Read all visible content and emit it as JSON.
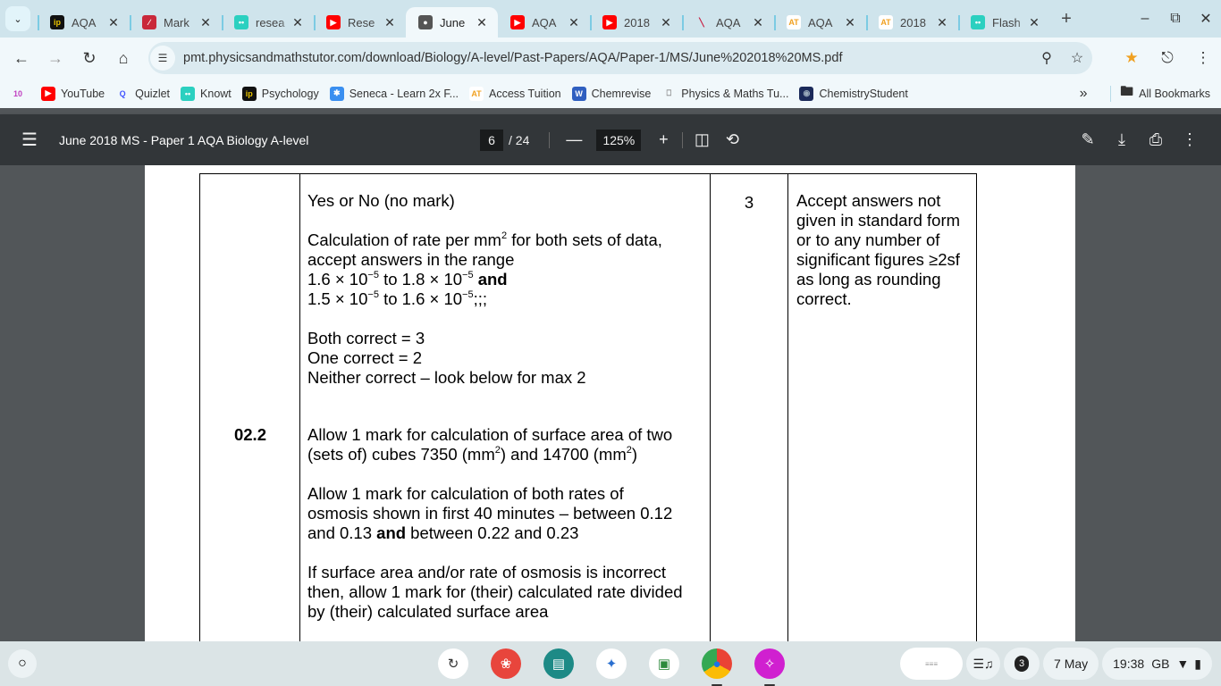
{
  "browser": {
    "tabs": [
      {
        "title": "AQA",
        "icon": "ip-icon",
        "fav_bg": "#111",
        "fav_fg": "#e9c300",
        "fav_txt": "ip"
      },
      {
        "title": "Mark",
        "icon": "markbook-icon",
        "fav_bg": "#c9283a",
        "fav_fg": "#fff",
        "fav_txt": "∕"
      },
      {
        "title": "resea",
        "icon": "knowt-icon",
        "fav_bg": "#2bd0c0",
        "fav_fg": "#fff",
        "fav_txt": "••"
      },
      {
        "title": "Rese",
        "icon": "youtube-icon",
        "fav_bg": "#f00",
        "fav_fg": "#fff",
        "fav_txt": "▶"
      },
      {
        "title": "June",
        "icon": "globe-icon",
        "fav_bg": "#555",
        "fav_fg": "#fff",
        "fav_txt": "●",
        "active": true
      },
      {
        "title": "AQA",
        "icon": "youtube-icon",
        "fav_bg": "#f00",
        "fav_fg": "#fff",
        "fav_txt": "▶"
      },
      {
        "title": "2018",
        "icon": "youtube-icon",
        "fav_bg": "#f00",
        "fav_fg": "#fff",
        "fav_txt": "▶"
      },
      {
        "title": "AQA",
        "icon": "aqa-icon",
        "fav_bg": "transparent",
        "fav_fg": "#c8173c",
        "fav_txt": "╲"
      },
      {
        "title": "AQA",
        "icon": "access-tuition-icon",
        "fav_bg": "#fff",
        "fav_fg": "#f0a020",
        "fav_txt": "AT"
      },
      {
        "title": "2018",
        "icon": "access-tuition-icon",
        "fav_bg": "#fff",
        "fav_fg": "#f0a020",
        "fav_txt": "AT"
      },
      {
        "title": "Flash",
        "icon": "knowt-icon",
        "fav_bg": "#2bd0c0",
        "fav_fg": "#fff",
        "fav_txt": "••"
      }
    ],
    "new_tab": "+",
    "window_controls": {
      "minimize": "–",
      "restore": "⧉",
      "close": "✕"
    },
    "url": "pmt.physicsandmathstutor.com/download/Biology/A-level/Past-Papers/AQA/Paper-1/MS/June%202018%20MS.pdf",
    "bookmarks": [
      {
        "label": "",
        "icon": "celebration-icon",
        "bg": "transparent",
        "fg": "#c040c0",
        "txt": "10"
      },
      {
        "label": "YouTube",
        "icon": "youtube-icon",
        "bg": "#f00",
        "fg": "#fff",
        "txt": "▶"
      },
      {
        "label": "Quizlet",
        "icon": "quizlet-icon",
        "bg": "transparent",
        "fg": "#4255ff",
        "txt": "Q"
      },
      {
        "label": "Knowt",
        "icon": "knowt-icon",
        "bg": "#2bd0c0",
        "fg": "#fff",
        "txt": "••"
      },
      {
        "label": "Psychology",
        "icon": "ip-icon",
        "bg": "#111",
        "fg": "#e9c300",
        "txt": "ip"
      },
      {
        "label": "Seneca - Learn 2x F...",
        "icon": "seneca-icon",
        "bg": "#3a8ff0",
        "fg": "#fff",
        "txt": "✱"
      },
      {
        "label": "Access Tuition",
        "icon": "access-tuition-icon",
        "bg": "#fff",
        "fg": "#f0a020",
        "txt": "AT"
      },
      {
        "label": "Chemrevise",
        "icon": "wordpress-icon",
        "bg": "#2f5fc0",
        "fg": "#fff",
        "txt": "W"
      },
      {
        "label": "Physics & Maths Tu...",
        "icon": "pmt-icon",
        "bg": "transparent",
        "fg": "#888",
        "txt": "⎕"
      },
      {
        "label": "ChemistryStudent",
        "icon": "chemistrystudent-icon",
        "bg": "#1b2a5a",
        "fg": "#9ab",
        "txt": "◉"
      }
    ],
    "more_bookmarks": "»",
    "all_bookmarks": "All Bookmarks"
  },
  "pdf_viewer": {
    "title": "June 2018 MS - Paper 1 AQA Biology A-level",
    "current_page": "6",
    "total_pages": "/ 24",
    "zoom": "125%"
  },
  "document": {
    "question_number": "02.2",
    "marks": "3",
    "answer": {
      "line1": "Yes or No (no mark)",
      "calc_pre": "Calculation of rate per mm",
      "calc_post": " for both sets of data,",
      "accept": "accept answers in the range",
      "r1a": "1.6 × 10",
      "r1b": " to 1.8 × 10",
      "and": "and",
      "r2a": "1.5 × 10",
      "r2b": " to 1.6 × 10",
      "r2end": ";;;",
      "exp": "−5",
      "sq": "2",
      "both": "Both correct = 3",
      "one": "One correct = 2",
      "neither": "Neither correct – look below for max 2",
      "sa1": "Allow 1 mark for calculation of surface area of two",
      "sa2a": "(sets of) cubes 7350 (mm",
      "sa2b": ") and 14700 (mm",
      "sa2c": ")",
      "os1": "Allow 1 mark for calculation of both rates of",
      "os2": "osmosis shown in first 40 minutes – between 0.12",
      "os3a": "and 0.13 ",
      "os3b": " between 0.22 and 0.23",
      "if1": "If surface area and/or rate of osmosis is incorrect",
      "if2": "then, allow 1 mark for (their) calculated rate divided",
      "if3": "by (their) calculated surface area"
    },
    "comments": [
      "Accept answers not",
      "given in standard form",
      "or to any number of",
      "significant figures ≥2sf",
      "as long as rounding",
      "correct."
    ]
  },
  "shelf": {
    "apps": [
      {
        "name": "cursive-app",
        "bg": "#fff",
        "fg": "#333",
        "txt": "↻"
      },
      {
        "name": "canvas-app",
        "bg": "#e8453c",
        "fg": "#fff",
        "txt": "❀"
      },
      {
        "name": "classroom-cards-app",
        "bg": "#1d8a86",
        "fg": "#fff",
        "txt": "▤"
      },
      {
        "name": "butterfly-app",
        "bg": "#fff",
        "fg": "#2a6fd0",
        "txt": "✦"
      },
      {
        "name": "google-classroom-app",
        "bg": "#fff",
        "fg": "#2d8a3c",
        "txt": "▣"
      },
      {
        "name": "chrome-app",
        "bg": "conic-gradient(#ea4335 0 33%,#fbbc05 0 66%,#34a853 0)",
        "fg": "#1a73e8",
        "txt": "●"
      },
      {
        "name": "gallery-app",
        "bg": "#d020d0",
        "fg": "#fff",
        "txt": "✧"
      }
    ],
    "notification_count": "3",
    "date": "7 May",
    "time": "19:38",
    "locale": "GB"
  }
}
